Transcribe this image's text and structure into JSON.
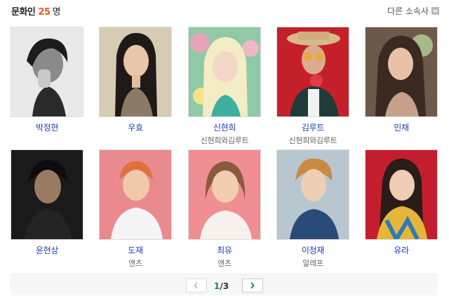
{
  "header": {
    "title": "문화인",
    "count": "25",
    "unit": "명",
    "other_link": "다른 소속사"
  },
  "people": [
    {
      "name": "박정현",
      "group": ""
    },
    {
      "name": "우효",
      "group": ""
    },
    {
      "name": "신현희",
      "group": "신현희와김루트"
    },
    {
      "name": "김루트",
      "group": "신현희와김루트"
    },
    {
      "name": "민채",
      "group": ""
    },
    {
      "name": "윤현상",
      "group": ""
    },
    {
      "name": "도재",
      "group": "앤츠"
    },
    {
      "name": "최유",
      "group": "앤츠"
    },
    {
      "name": "이정재",
      "group": "알레프"
    },
    {
      "name": "유라",
      "group": ""
    }
  ],
  "pagination": {
    "current": "1",
    "separator": "/",
    "total": "3"
  },
  "colors": {
    "accent_count": "#f2561e",
    "name_link": "#1a3dbf",
    "page_current": "#0b8e3a"
  }
}
